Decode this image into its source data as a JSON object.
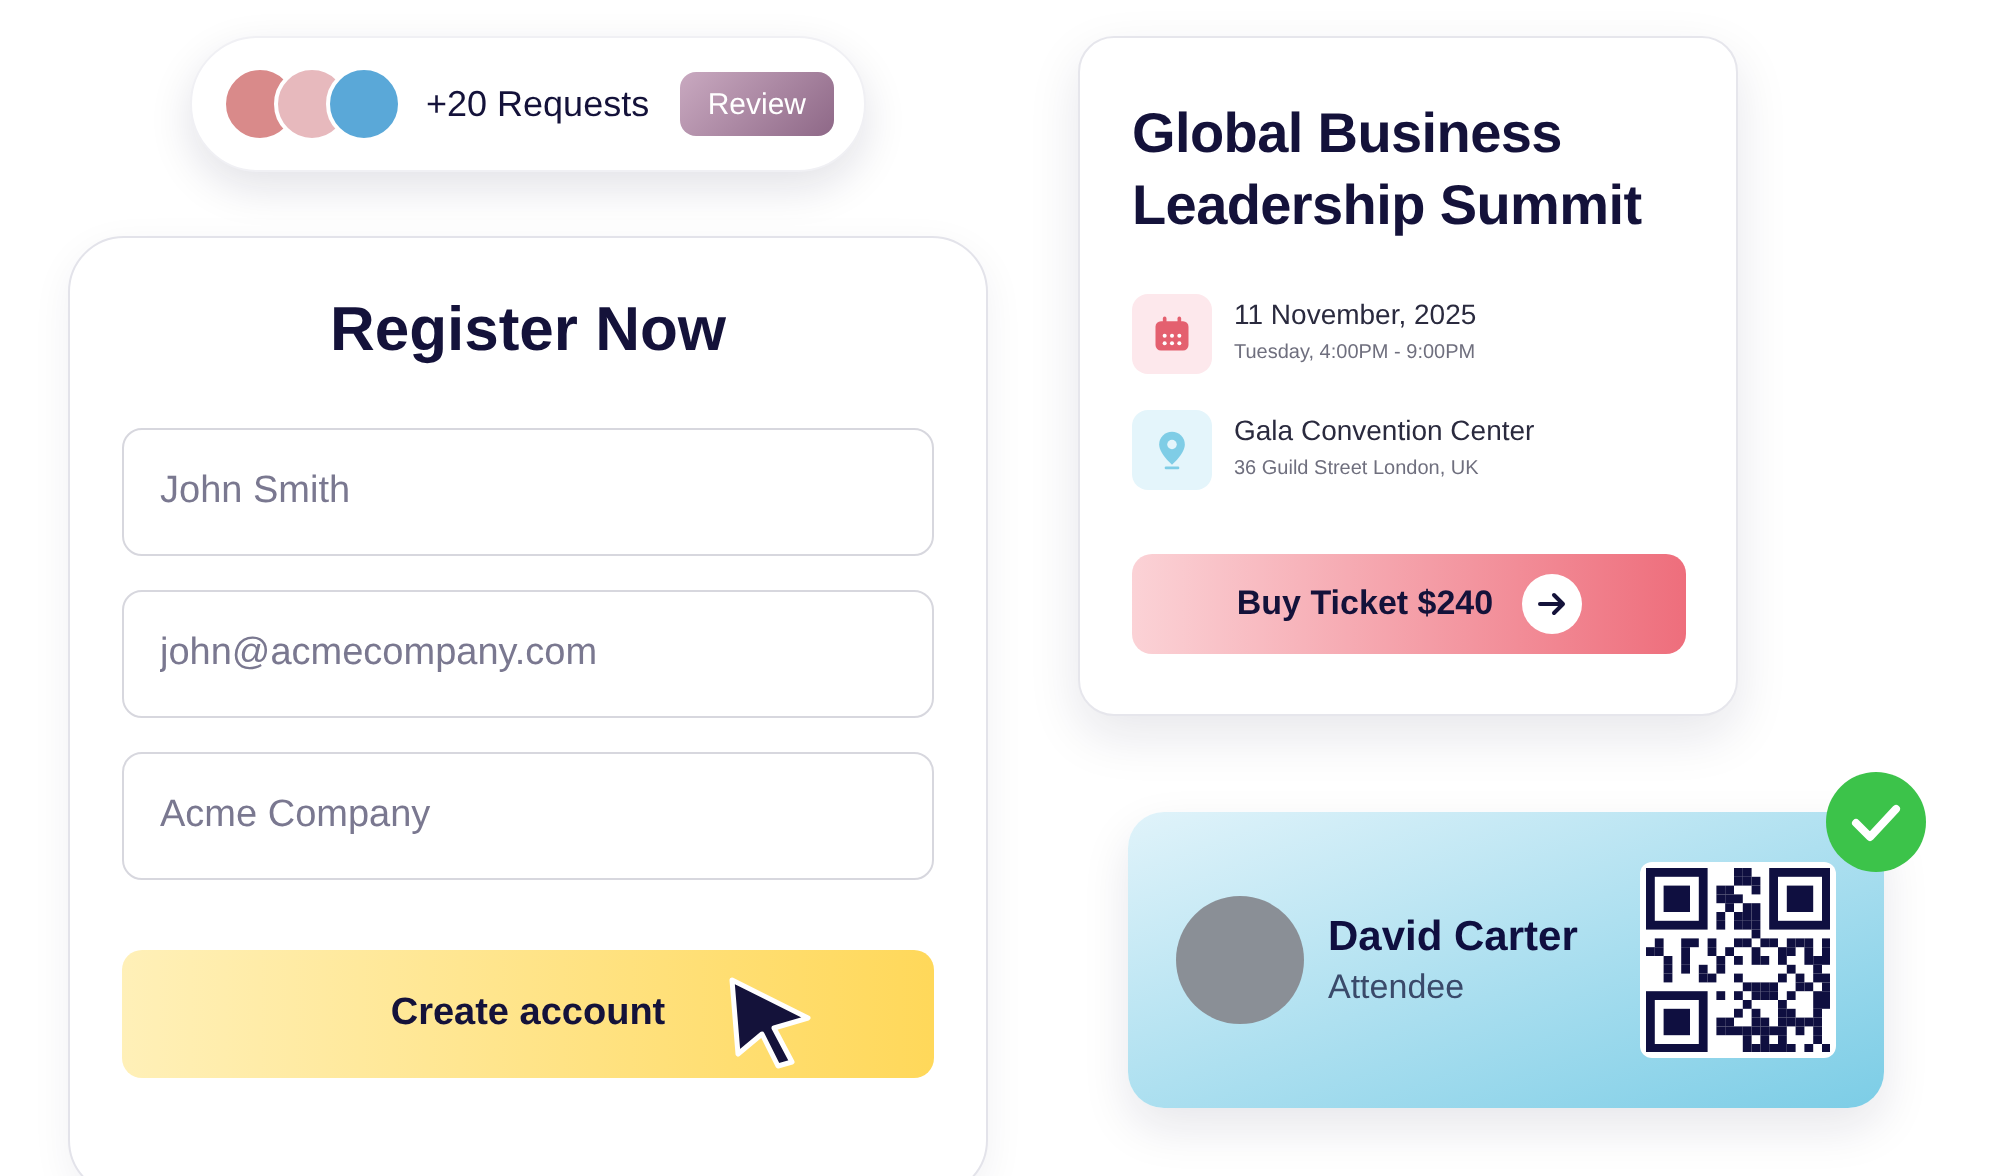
{
  "requests": {
    "label": "+20 Requests",
    "button": "Review"
  },
  "register": {
    "title": "Register Now",
    "fields": [
      {
        "placeholder": "John Smith"
      },
      {
        "placeholder": "john@acmecompany.com"
      },
      {
        "placeholder": "Acme Company"
      }
    ],
    "submit": "Create account"
  },
  "event": {
    "title": "Global Business Leadership Summit",
    "details": [
      {
        "kind": "date",
        "primary": "11 November, 2025",
        "secondary": "Tuesday, 4:00PM - 9:00PM"
      },
      {
        "kind": "location",
        "primary": "Gala Convention Center",
        "secondary": "36 Guild Street London, UK"
      }
    ],
    "button": "Buy Ticket $240"
  },
  "ticket": {
    "name": "David Carter",
    "role": "Attendee",
    "verified": true
  }
}
